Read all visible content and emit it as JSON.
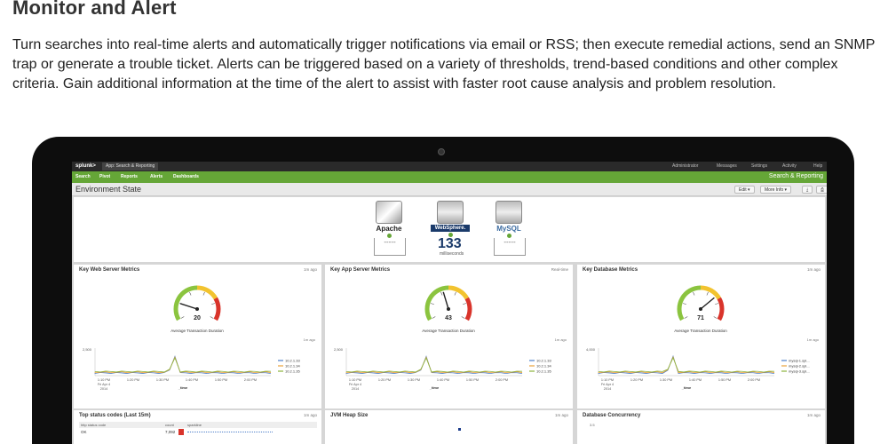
{
  "heading": "Monitor and Alert",
  "paragraph": "Turn searches into real-time alerts and automatically trigger notifications via email or RSS; then execute remedial actions, send an SNMP trap or generate a trouble ticket. Alerts can be triggered based on a variety of thresholds, trend-based conditions and other complex criteria. Gain additional information at the time of the alert to assist with faster root cause analysis and problem resolution.",
  "app": {
    "logo": "splunk>",
    "app_menu": "App: Search & Reporting",
    "top_right": [
      "Administrator",
      "Messages",
      "Settings",
      "Activity",
      "Help"
    ],
    "nav": [
      "Search",
      "Pivot",
      "Reports",
      "Alerts",
      "Dashboards"
    ],
    "app_title": "Search & Reporting",
    "page_title": "Environment State",
    "edit_label": "Edit",
    "more_info_label": "More Info",
    "env": {
      "servers": [
        "Apache",
        "WebSphere.",
        "MySQL"
      ],
      "response": "133",
      "response_unit": "milliseconds",
      "placeholder": "-----"
    },
    "colors": {
      "nav_green": "#65a637",
      "topbar": "#2a2a2a"
    },
    "panels": [
      {
        "title": "Key Web Server Metrics",
        "ago": "1m ago",
        "gauge_value": 20,
        "chart_title": "Average Transaction Duration",
        "chart_ago": "1m ago",
        "ymax": "2,500",
        "xticks": [
          "1:10 PM\nFri Apr 4\n2014",
          "1:20 PM",
          "1:30 PM",
          "1:40 PM",
          "1:50 PM",
          "2:00 PM"
        ],
        "xlabel": "_time",
        "legend": [
          "10.2.1.33",
          "10.2.1.34",
          "10.2.1.35"
        ],
        "legend_colors": [
          "#4d7fc9",
          "#e8a13a",
          "#8bb43d"
        ]
      },
      {
        "title": "Key App Server Metrics",
        "ago": "Real-time",
        "gauge_value": 43,
        "chart_title": "Average Transaction Duration",
        "chart_ago": "1m ago",
        "ymax": "2,500",
        "xticks": [
          "1:10 PM\nFri Apr 4\n2014",
          "1:20 PM",
          "1:30 PM",
          "1:40 PM",
          "1:50 PM",
          "2:00 PM"
        ],
        "xlabel": "_time",
        "legend": [
          "10.2.1.33",
          "10.2.1.34",
          "10.2.1.35"
        ],
        "legend_colors": [
          "#4d7fc9",
          "#e8a13a",
          "#8bb43d"
        ]
      },
      {
        "title": "Key Database Metrics",
        "ago": "1m ago",
        "gauge_value": 71,
        "chart_title": "Average Transaction Duration",
        "chart_ago": "1m ago",
        "ymax": "4,000",
        "xticks": [
          "1:10 PM\nFri Apr 4\n2014",
          "1:20 PM",
          "1:30 PM",
          "1:40 PM",
          "1:50 PM",
          "2:00 PM"
        ],
        "xlabel": "_time",
        "legend": [
          "mysql-1.spl...",
          "mysql-2.spl...",
          "mysql-3.spl..."
        ],
        "legend_colors": [
          "#4d7fc9",
          "#e8a13a",
          "#8bb43d"
        ]
      }
    ],
    "bottom_panels": [
      {
        "title": "Top status codes (Last 15m)",
        "ago": "1m ago",
        "cols": [
          "http status code",
          "count",
          "sparkline"
        ],
        "row": [
          "OK",
          "7,092"
        ]
      },
      {
        "title": "JVM Heap Size",
        "ago": "1m ago"
      },
      {
        "title": "Database Concurrency",
        "ago": "1m ago",
        "ymax": "3.5"
      }
    ]
  }
}
